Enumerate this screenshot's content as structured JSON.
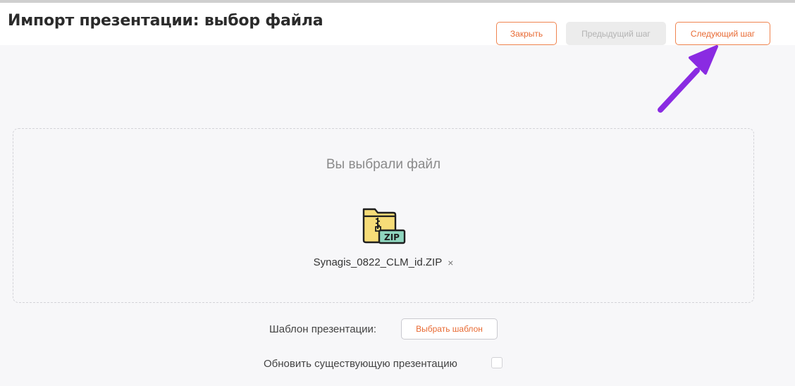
{
  "header": {
    "title": "Импорт презентации: выбор файла",
    "close_label": "Закрыть",
    "prev_label": "Предыдущий шаг",
    "next_label": "Следующий шаг"
  },
  "dropzone": {
    "caption": "Вы выбрали файл",
    "file_icon": "zip-file-icon",
    "file_icon_text": "ZIP",
    "file_name": "Synagis_0822_CLM_id.ZIP",
    "remove_glyph": "×"
  },
  "template": {
    "label": "Шаблон презентации:",
    "button_label": "Выбрать шаблон"
  },
  "update": {
    "label": "Обновить существующую презентацию",
    "checked": false
  },
  "colors": {
    "accent": "#e86a33",
    "annotation_arrow": "#8a2be2"
  }
}
